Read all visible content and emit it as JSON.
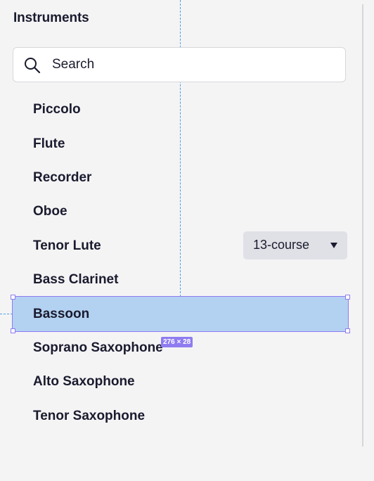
{
  "panel": {
    "title": "Instruments"
  },
  "search": {
    "placeholder": "Search",
    "icon": "search-icon"
  },
  "instruments": [
    {
      "label": "Piccolo"
    },
    {
      "label": "Flute"
    },
    {
      "label": "Recorder"
    },
    {
      "label": "Oboe"
    },
    {
      "label": "Tenor Lute",
      "option": "13-course"
    },
    {
      "label": "Bass Clarinet"
    },
    {
      "label": "Bassoon",
      "selected": true
    },
    {
      "label": "Soprano Saxophone"
    },
    {
      "label": "Alto Saxophone"
    },
    {
      "label": "Tenor Saxophone"
    }
  ],
  "selection_overlay": {
    "size_label": "276 × 28"
  },
  "colors": {
    "background": "#f4f4f5",
    "text": "#1a1b2e",
    "selected_row": "#b3d1f1",
    "selection_outline": "#8f7cf0",
    "guide_line": "#4a9fe6",
    "select_background": "#dfe1e6"
  }
}
